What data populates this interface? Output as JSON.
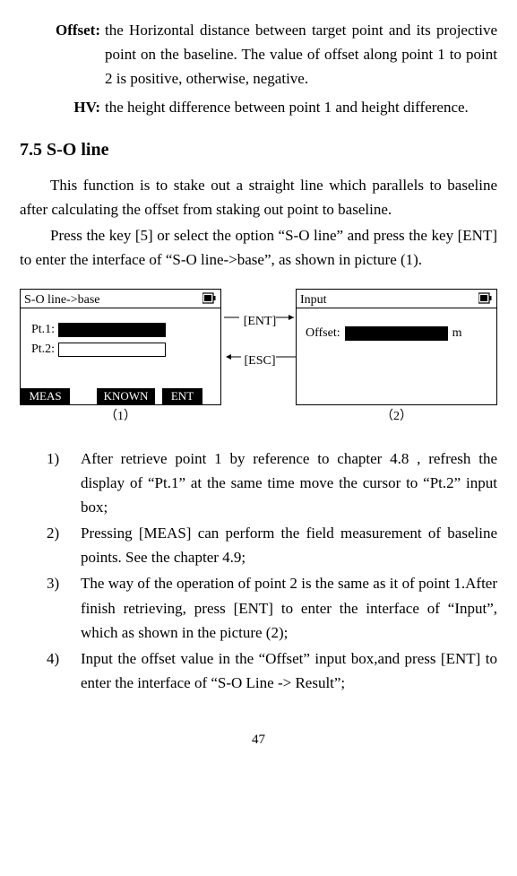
{
  "defs": {
    "offset": {
      "term": "Offset:",
      "body": "the Horizontal distance between target point and its projective point on the baseline. The value of offset along point 1 to point 2 is positive, otherwise, negative."
    },
    "hv": {
      "term": "HV:",
      "body": "the height difference between point 1 and height difference."
    }
  },
  "section": {
    "title": "7.5 S-O line",
    "p1": "This function is to stake out a straight line which parallels to baseline after calculating the offset from staking out point to baseline.",
    "p2": "Press the key [5] or select the option “S-O line” and press the key [ENT] to enter the interface of “S-O line->base”, as shown in picture (1)."
  },
  "diagram": {
    "screen1": {
      "title": "S-O  line->base",
      "pt1": "Pt.1:",
      "pt2": "Pt.2:",
      "btn_meas": "MEAS",
      "btn_known": "KNOWN",
      "btn_ent": "ENT",
      "caption": "（1）"
    },
    "arrows": {
      "ent": "[ENT]",
      "esc": "[ESC]"
    },
    "screen2": {
      "title": "Input",
      "offset": "Offset:",
      "unit": "m",
      "caption": "（2）"
    }
  },
  "steps": {
    "s1": "After retrieve point 1 by reference to chapter 4.8 , refresh the display of “Pt.1” at the same time move the cursor to “Pt.2” input box;",
    "s2": "Pressing [MEAS] can perform the field measurement of baseline points. See the chapter 4.9;",
    "s3": "The way of the operation of point 2 is the same as it of point 1.After finish retrieving, press [ENT] to enter the interface of “Input”, which as shown in the picture (2);",
    "s4": "Input the offset value in the “Offset” input box,and press [ENT] to enter the interface of “S-O Line -> Result”;"
  },
  "page": "47"
}
